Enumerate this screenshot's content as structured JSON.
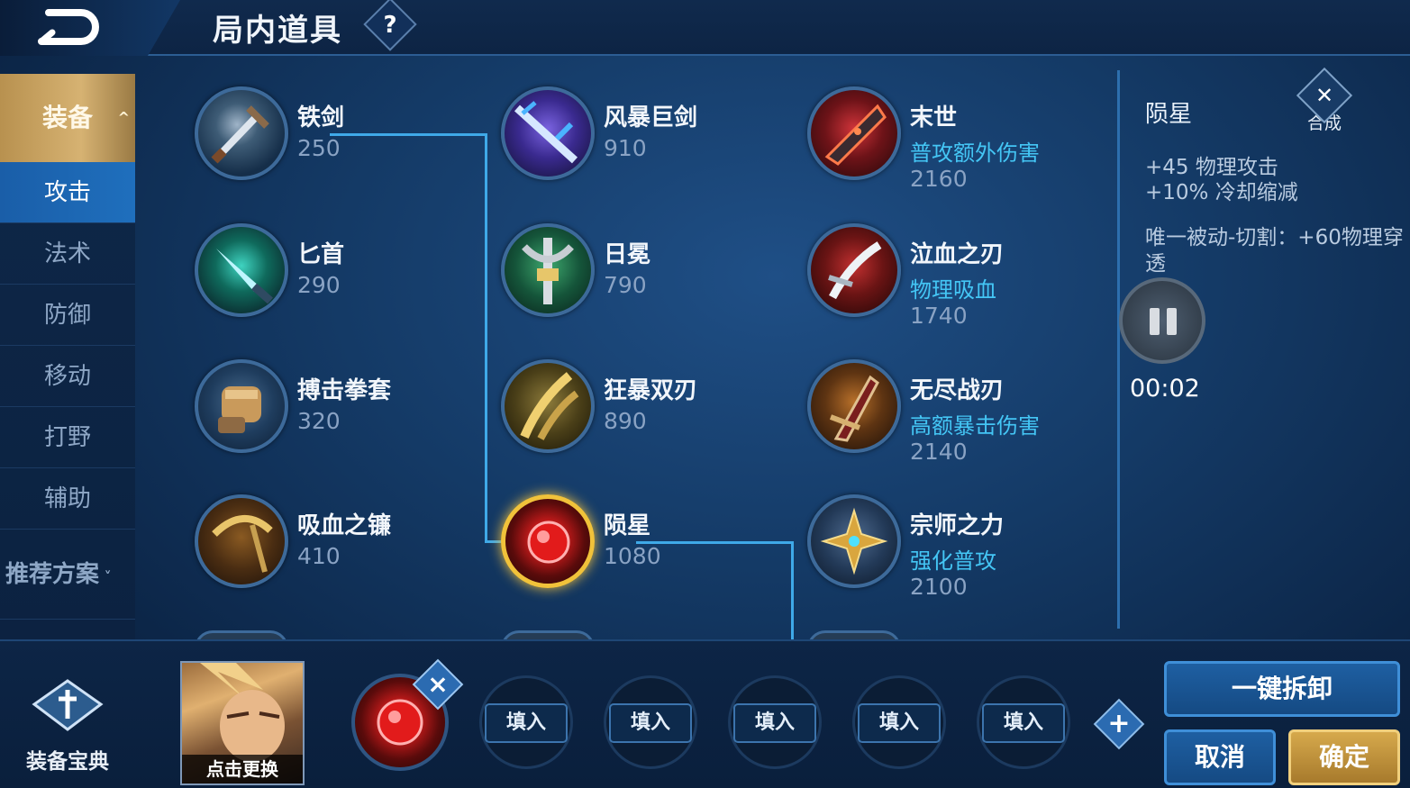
{
  "header": {
    "title": "局内道具",
    "help_label": "?"
  },
  "sidebar": {
    "header_label": "装备",
    "items": [
      {
        "label": "攻击",
        "active": true
      },
      {
        "label": "法术",
        "active": false
      },
      {
        "label": "防御",
        "active": false
      },
      {
        "label": "移动",
        "active": false
      },
      {
        "label": "打野",
        "active": false
      },
      {
        "label": "辅助",
        "active": false
      }
    ],
    "recommend_label": "推荐方案"
  },
  "grid": {
    "col1": [
      {
        "name": "铁剑",
        "price": "250",
        "icon": "iron-sword-icon"
      },
      {
        "name": "匕首",
        "price": "290",
        "icon": "dagger-icon"
      },
      {
        "name": "搏击拳套",
        "price": "320",
        "icon": "boxing-glove-icon"
      },
      {
        "name": "吸血之镰",
        "price": "410",
        "icon": "lifesteal-scythe-icon"
      }
    ],
    "col2": [
      {
        "name": "风暴巨剑",
        "price": "910",
        "icon": "storm-greatsword-icon"
      },
      {
        "name": "日冕",
        "price": "790",
        "icon": "corona-icon"
      },
      {
        "name": "狂暴双刃",
        "price": "890",
        "icon": "berserk-blades-icon"
      },
      {
        "name": "陨星",
        "price": "1080",
        "icon": "meteor-icon",
        "selected": true
      }
    ],
    "col3": [
      {
        "name": "末世",
        "tag": "普攻额外伤害",
        "price": "2160",
        "icon": "doomsday-icon"
      },
      {
        "name": "泣血之刃",
        "tag": "物理吸血",
        "price": "1740",
        "icon": "bloodweep-blade-icon"
      },
      {
        "name": "无尽战刃",
        "tag": "高额暴击伤害",
        "price": "2140",
        "icon": "infinity-edge-icon"
      },
      {
        "name": "宗师之力",
        "tag": "强化普攻",
        "price": "2100",
        "icon": "masters-might-icon"
      }
    ]
  },
  "detail": {
    "name": "陨星",
    "compose_label": "合成",
    "stats": [
      "+45 物理攻击",
      "+10% 冷却缩减"
    ],
    "passive": "唯一被动-切割：+60物理穿透"
  },
  "player": {
    "timer": "00:02"
  },
  "bottom": {
    "codex_label": "装备宝典",
    "hero_change_label": "点击更换",
    "slot_fill_label": "填入",
    "unequip_all": "一键拆卸",
    "cancel": "取消",
    "confirm": "确定"
  },
  "colors": {
    "accent": "#3fa9e8",
    "gold": "#f1c23a",
    "tag_blue": "#44c6f5"
  }
}
